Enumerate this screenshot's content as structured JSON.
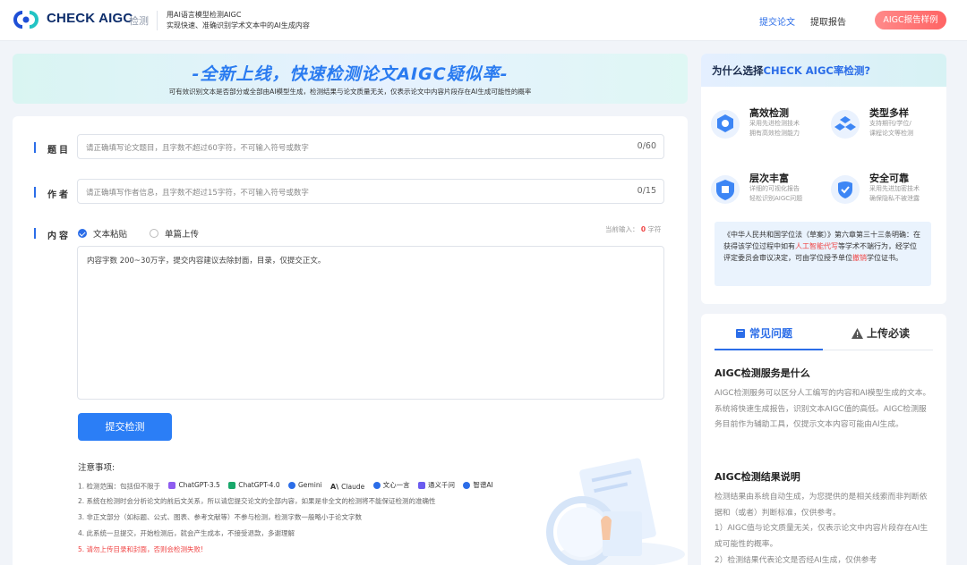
{
  "header": {
    "brand": "CHECK AIGC",
    "brand_sub": "检测",
    "slogan_line1": "用AI语言模型检测AIGC",
    "slogan_line2": "实现快速、准确识别学术文本中的AI生成内容",
    "nav": {
      "submit": "提交论文",
      "report": "提取报告",
      "sample": "AIGC报告样例"
    }
  },
  "banner": {
    "title": "-全新上线，快速检测论文AIGC疑似率-",
    "subtitle": "可有效识别文本是否部分或全部由AI模型生成，检测结果与论文质量无关，仅表示论文中内容片段存在AI生成可能性的概率"
  },
  "form": {
    "title_label": "题目",
    "title_placeholder": "请正确填写论文题目，且字数不超过60字符，不可输入符号或数字",
    "title_count": "0/60",
    "author_label": "作者",
    "author_placeholder": "请正确填写作者信息，且字数不超过15字符，不可输入符号或数字",
    "author_count": "0/15",
    "content_label": "内容",
    "option_paste": "文本粘贴",
    "option_upload": "单篇上传",
    "current_input_prefix": "当前输入：",
    "current_input_value": "0",
    "current_input_unit": "字符",
    "content_placeholder": "内容字数 200~30万字，提交内容建议去除封面，目录，仅提交正文。",
    "submit": "提交检测"
  },
  "notes": {
    "title": "注意事项:",
    "item1": "1. 检测范围：包括但不限于",
    "models": [
      {
        "name": "ChatGPT-3.5",
        "color": "#8e5cf0"
      },
      {
        "name": "ChatGPT-4.0",
        "color": "#19a86b"
      },
      {
        "name": "Gemini",
        "color": "#2b6de8"
      },
      {
        "name": "Claude",
        "color": "#222222"
      },
      {
        "name": "文心一言",
        "color": "#2b6de8"
      },
      {
        "name": "通义千问",
        "color": "#6b5cf0"
      },
      {
        "name": "智谱AI",
        "color": "#2b6de8"
      }
    ],
    "item2": "2. 系统在检测时会分析论文的前后文关系，所以请您提交论文的全部内容，如果是非全文的检测将不能保证检测的准确性",
    "item3": "3. 非正文部分（如标题、公式、图表、参考文献等）不参与检测，检测字数一般略小于论文字数",
    "item4": "4. 此系统一旦提交，开始检测后，就会产生成本，不接受退款，多谢理解",
    "item5": "5. 请勿上传目录和封面，否则会检测失败!"
  },
  "why": {
    "title_prefix": "为什么选择",
    "title_brand": "CHECK AIGC率检测?",
    "features": [
      {
        "title": "高效检测",
        "line1": "采用先进检测技术",
        "line2": "拥有高效检测能力"
      },
      {
        "title": "类型多样",
        "line1": "支持期刊/学位/",
        "line2": "课程论文等检测"
      },
      {
        "title": "层次丰富",
        "line1": "详细的可视化报告",
        "line2": "轻松识别AIGC问题"
      },
      {
        "title": "安全可靠",
        "line1": "采用先进加密技术",
        "line2": "确保隐私不被泄露"
      }
    ],
    "law_pre": "《中华人民共和国学位法（草案）》第六章第三十三条明确：在获得该学位过程中如有",
    "law_red1": "人工智能代写",
    "law_mid": "等学术不端行为，经学位评定委员会审议决定，可由学位授予单位",
    "law_red2": "撤销",
    "law_post": "学位证书。"
  },
  "faq": {
    "tab_faq": "常见问题",
    "tab_upload": "上传必读",
    "q1": "AIGC检测服务是什么",
    "a1": "AIGC检测服务可以区分人工编写的内容和AI模型生成的文本。 系统将快速生成报告，识别文本AIGC值的高低。AIGC检测服务目前作为辅助工具，仅提示文本内容可能由AI生成。",
    "q2": "AIGC检测结果说明",
    "a2_1": "检测结果由系统自动生成，为您提供的是相关线索而非判断依据和（或者）判断标准，仅供参考。",
    "a2_2": "1）AIGC值与论文质量无关，仅表示论文中内容片段存在AI生成可能性的概率。",
    "a2_3": "2）检测结果代表论文是否经AI生成，仅供参考"
  }
}
